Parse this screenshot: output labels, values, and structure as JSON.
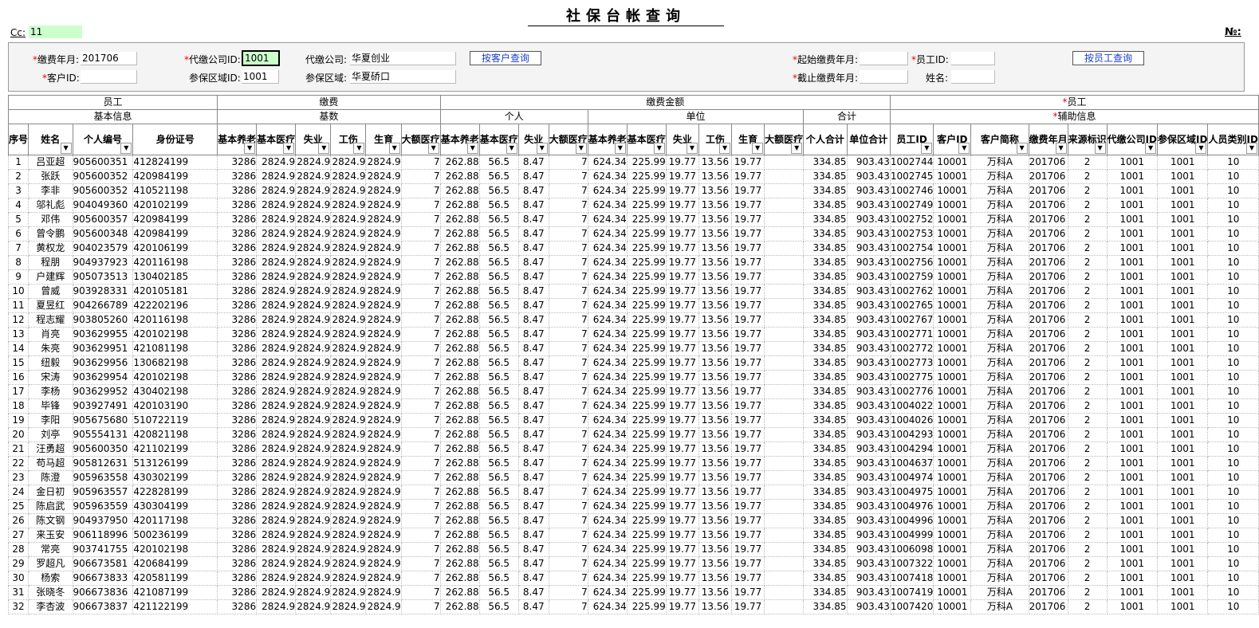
{
  "title": "社保台帐查询",
  "cc": {
    "label": "Cc:",
    "value": "11"
  },
  "no_label": "№:",
  "form": {
    "pay_month_label": "缴费年月:",
    "pay_month": "201706",
    "agent_company_id_label": "代缴公司ID:",
    "agent_company_id": "1001",
    "agent_company_label": "代缴公司:",
    "agent_company": "华夏创业",
    "customer_query_btn": "按客户查询",
    "start_month_label": "起始缴费年月:",
    "start_month": "",
    "employee_id_label": "员工ID:",
    "employee_id": "",
    "employee_query_btn": "按员工查询",
    "customer_id_label": "客户ID:",
    "customer_id": "",
    "region_id_label": "参保区域ID:",
    "region_id": "1001",
    "region_label": "参保区域:",
    "region": "华夏硚口",
    "end_month_label": "截止缴费年月:",
    "end_month": "",
    "name_label": "姓名:",
    "name": ""
  },
  "groups": {
    "employee": "员工",
    "basic_info": "基本信息",
    "payment": "缴费",
    "base": "基数",
    "amount": "缴费金额",
    "personal": "个人",
    "unit": "单位",
    "total": "合计",
    "employee2": "员工",
    "aux_info": "辅助信息"
  },
  "columns": [
    "序号",
    "姓名",
    "个人编号",
    "身份证号",
    "基本养老",
    "基本医疗",
    "失业",
    "工伤",
    "生育",
    "大额医疗",
    "基本养老",
    "基本医疗",
    "失业",
    "大额医疗",
    "基本养老",
    "基本医疗",
    "失业",
    "工伤",
    "生育",
    "大额医疗",
    "个人合计",
    "单位合计",
    "员工ID",
    "客户ID",
    "客户简称",
    "缴费年月",
    "来源标识",
    "代缴公司ID",
    "参保区域ID",
    "人员类别ID"
  ],
  "rows": [
    [
      "1",
      "吕亚超",
      "905600351",
      "412824199",
      "3286",
      "2824.9",
      "2824.9",
      "2824.9",
      "2824.9",
      "7",
      "262.88",
      "56.5",
      "8.47",
      "7",
      "624.34",
      "225.99",
      "19.77",
      "13.56",
      "19.77",
      "",
      "334.85",
      "903.43",
      "1002744",
      "10001",
      "万科A",
      "201706",
      "2",
      "1001",
      "1001",
      "10"
    ],
    [
      "2",
      "张跃",
      "905600352",
      "420984199",
      "3286",
      "2824.9",
      "2824.9",
      "2824.9",
      "2824.9",
      "7",
      "262.88",
      "56.5",
      "8.47",
      "7",
      "624.34",
      "225.99",
      "19.77",
      "13.56",
      "19.77",
      "",
      "334.85",
      "903.43",
      "1002745",
      "10001",
      "万科A",
      "201706",
      "2",
      "1001",
      "1001",
      "10"
    ],
    [
      "3",
      "李非",
      "905600352",
      "410521198",
      "3286",
      "2824.9",
      "2824.9",
      "2824.9",
      "2824.9",
      "7",
      "262.88",
      "56.5",
      "8.47",
      "7",
      "624.34",
      "225.99",
      "19.77",
      "13.56",
      "19.77",
      "",
      "334.85",
      "903.43",
      "1002746",
      "10001",
      "万科A",
      "201706",
      "2",
      "1001",
      "1001",
      "10"
    ],
    [
      "4",
      "邬礼彪",
      "904049360",
      "420102199",
      "3286",
      "2824.9",
      "2824.9",
      "2824.9",
      "2824.9",
      "7",
      "262.88",
      "56.5",
      "8.47",
      "7",
      "624.34",
      "225.99",
      "19.77",
      "13.56",
      "19.77",
      "",
      "334.85",
      "903.43",
      "1002749",
      "10001",
      "万科A",
      "201706",
      "2",
      "1001",
      "1001",
      "10"
    ],
    [
      "5",
      "邓伟",
      "905600357",
      "420984199",
      "3286",
      "2824.9",
      "2824.9",
      "2824.9",
      "2824.9",
      "7",
      "262.88",
      "56.5",
      "8.47",
      "7",
      "624.34",
      "225.99",
      "19.77",
      "13.56",
      "19.77",
      "",
      "334.85",
      "903.43",
      "1002752",
      "10001",
      "万科A",
      "201706",
      "2",
      "1001",
      "1001",
      "10"
    ],
    [
      "6",
      "曾令鹏",
      "905600348",
      "420984199",
      "3286",
      "2824.9",
      "2824.9",
      "2824.9",
      "2824.9",
      "7",
      "262.88",
      "56.5",
      "8.47",
      "7",
      "624.34",
      "225.99",
      "19.77",
      "13.56",
      "19.77",
      "",
      "334.85",
      "903.43",
      "1002753",
      "10001",
      "万科A",
      "201706",
      "2",
      "1001",
      "1001",
      "10"
    ],
    [
      "7",
      "黄权龙",
      "904023579",
      "420106199",
      "3286",
      "2824.9",
      "2824.9",
      "2824.9",
      "2824.9",
      "7",
      "262.88",
      "56.5",
      "8.47",
      "7",
      "624.34",
      "225.99",
      "19.77",
      "13.56",
      "19.77",
      "",
      "334.85",
      "903.43",
      "1002754",
      "10001",
      "万科A",
      "201706",
      "2",
      "1001",
      "1001",
      "10"
    ],
    [
      "8",
      "程朋",
      "904937923",
      "420116198",
      "3286",
      "2824.9",
      "2824.9",
      "2824.9",
      "2824.9",
      "7",
      "262.88",
      "56.5",
      "8.47",
      "7",
      "624.34",
      "225.99",
      "19.77",
      "13.56",
      "19.77",
      "",
      "334.85",
      "903.43",
      "1002756",
      "10001",
      "万科A",
      "201706",
      "2",
      "1001",
      "1001",
      "10"
    ],
    [
      "9",
      "户建辉",
      "905073513",
      "130402185",
      "3286",
      "2824.9",
      "2824.9",
      "2824.9",
      "2824.9",
      "7",
      "262.88",
      "56.5",
      "8.47",
      "7",
      "624.34",
      "225.99",
      "19.77",
      "13.56",
      "19.77",
      "",
      "334.85",
      "903.43",
      "1002759",
      "10001",
      "万科A",
      "201706",
      "2",
      "1001",
      "1001",
      "10"
    ],
    [
      "10",
      "曾威",
      "903928331",
      "420105181",
      "3286",
      "2824.9",
      "2824.9",
      "2824.9",
      "2824.9",
      "7",
      "262.88",
      "56.5",
      "8.47",
      "7",
      "624.34",
      "225.99",
      "19.77",
      "13.56",
      "19.77",
      "",
      "334.85",
      "903.43",
      "1002762",
      "10001",
      "万科A",
      "201706",
      "2",
      "1001",
      "1001",
      "10"
    ],
    [
      "11",
      "夏昱红",
      "904266789",
      "422202196",
      "3286",
      "2824.9",
      "2824.9",
      "2824.9",
      "2824.9",
      "7",
      "262.88",
      "56.5",
      "8.47",
      "7",
      "624.34",
      "225.99",
      "19.77",
      "13.56",
      "19.77",
      "",
      "334.85",
      "903.43",
      "1002765",
      "10001",
      "万科A",
      "201706",
      "2",
      "1001",
      "1001",
      "10"
    ],
    [
      "12",
      "程志耀",
      "903805260",
      "420116198",
      "3286",
      "2824.9",
      "2824.9",
      "2824.9",
      "2824.9",
      "7",
      "262.88",
      "56.5",
      "8.47",
      "7",
      "624.34",
      "225.99",
      "19.77",
      "13.56",
      "19.77",
      "",
      "334.85",
      "903.43",
      "1002767",
      "10001",
      "万科A",
      "201706",
      "2",
      "1001",
      "1001",
      "10"
    ],
    [
      "13",
      "肖亮",
      "903629955",
      "420102198",
      "3286",
      "2824.9",
      "2824.9",
      "2824.9",
      "2824.9",
      "7",
      "262.88",
      "56.5",
      "8.47",
      "7",
      "624.34",
      "225.99",
      "19.77",
      "13.56",
      "19.77",
      "",
      "334.85",
      "903.43",
      "1002771",
      "10001",
      "万科A",
      "201706",
      "2",
      "1001",
      "1001",
      "10"
    ],
    [
      "14",
      "朱亮",
      "903629951",
      "421081198",
      "3286",
      "2824.9",
      "2824.9",
      "2824.9",
      "2824.9",
      "7",
      "262.88",
      "56.5",
      "8.47",
      "7",
      "624.34",
      "225.99",
      "19.77",
      "13.56",
      "19.77",
      "",
      "334.85",
      "903.43",
      "1002772",
      "10001",
      "万科A",
      "201706",
      "2",
      "1001",
      "1001",
      "10"
    ],
    [
      "15",
      "纽毅",
      "903629956",
      "130682198",
      "3286",
      "2824.9",
      "2824.9",
      "2824.9",
      "2824.9",
      "7",
      "262.88",
      "56.5",
      "8.47",
      "7",
      "624.34",
      "225.99",
      "19.77",
      "13.56",
      "19.77",
      "",
      "334.85",
      "903.43",
      "1002773",
      "10001",
      "万科A",
      "201706",
      "2",
      "1001",
      "1001",
      "10"
    ],
    [
      "16",
      "宋涛",
      "903629954",
      "420102198",
      "3286",
      "2824.9",
      "2824.9",
      "2824.9",
      "2824.9",
      "7",
      "262.88",
      "56.5",
      "8.47",
      "7",
      "624.34",
      "225.99",
      "19.77",
      "13.56",
      "19.77",
      "",
      "334.85",
      "903.43",
      "1002775",
      "10001",
      "万科A",
      "201706",
      "2",
      "1001",
      "1001",
      "10"
    ],
    [
      "17",
      "李杨",
      "903629952",
      "430402198",
      "3286",
      "2824.9",
      "2824.9",
      "2824.9",
      "2824.9",
      "7",
      "262.88",
      "56.5",
      "8.47",
      "7",
      "624.34",
      "225.99",
      "19.77",
      "13.56",
      "19.77",
      "",
      "334.85",
      "903.43",
      "1002776",
      "10001",
      "万科A",
      "201706",
      "2",
      "1001",
      "1001",
      "10"
    ],
    [
      "18",
      "毕锋",
      "903927491",
      "420103190",
      "3286",
      "2824.9",
      "2824.9",
      "2824.9",
      "2824.9",
      "7",
      "262.88",
      "56.5",
      "8.47",
      "7",
      "624.34",
      "225.99",
      "19.77",
      "13.56",
      "19.77",
      "",
      "334.85",
      "903.43",
      "1004022",
      "10001",
      "万科A",
      "201706",
      "2",
      "1001",
      "1001",
      "10"
    ],
    [
      "19",
      "李阳",
      "905675680",
      "510722119",
      "3286",
      "2824.9",
      "2824.9",
      "2824.9",
      "2824.9",
      "7",
      "262.88",
      "56.5",
      "8.47",
      "7",
      "624.34",
      "225.99",
      "19.77",
      "13.56",
      "19.77",
      "",
      "334.85",
      "903.43",
      "1004026",
      "10001",
      "万科A",
      "201706",
      "2",
      "1001",
      "1001",
      "10"
    ],
    [
      "20",
      "刘亭",
      "905554131",
      "420821198",
      "3286",
      "2824.9",
      "2824.9",
      "2824.9",
      "2824.9",
      "7",
      "262.88",
      "56.5",
      "8.47",
      "7",
      "624.34",
      "225.99",
      "19.77",
      "13.56",
      "19.77",
      "",
      "334.85",
      "903.43",
      "1004293",
      "10001",
      "万科A",
      "201706",
      "2",
      "1001",
      "1001",
      "10"
    ],
    [
      "21",
      "汪勇超",
      "905600350",
      "421102199",
      "3286",
      "2824.9",
      "2824.9",
      "2824.9",
      "2824.9",
      "7",
      "262.88",
      "56.5",
      "8.47",
      "7",
      "624.34",
      "225.99",
      "19.77",
      "13.56",
      "19.77",
      "",
      "334.85",
      "903.43",
      "1004294",
      "10001",
      "万科A",
      "201706",
      "2",
      "1001",
      "1001",
      "10"
    ],
    [
      "22",
      "苟马超",
      "905812631",
      "513126199",
      "3286",
      "2824.9",
      "2824.9",
      "2824.9",
      "2824.9",
      "7",
      "262.88",
      "56.5",
      "8.47",
      "7",
      "624.34",
      "225.99",
      "19.77",
      "13.56",
      "19.77",
      "",
      "334.85",
      "903.43",
      "1004637",
      "10001",
      "万科A",
      "201706",
      "2",
      "1001",
      "1001",
      "10"
    ],
    [
      "23",
      "陈澄",
      "905963558",
      "430302199",
      "3286",
      "2824.9",
      "2824.9",
      "2824.9",
      "2824.9",
      "7",
      "262.88",
      "56.5",
      "8.47",
      "7",
      "624.34",
      "225.99",
      "19.77",
      "13.56",
      "19.77",
      "",
      "334.85",
      "903.43",
      "1004974",
      "10001",
      "万科A",
      "201706",
      "2",
      "1001",
      "1001",
      "10"
    ],
    [
      "24",
      "金日初",
      "905963557",
      "422828199",
      "3286",
      "2824.9",
      "2824.9",
      "2824.9",
      "2824.9",
      "7",
      "262.88",
      "56.5",
      "8.47",
      "7",
      "624.34",
      "225.99",
      "19.77",
      "13.56",
      "19.77",
      "",
      "334.85",
      "903.43",
      "1004975",
      "10001",
      "万科A",
      "201706",
      "2",
      "1001",
      "1001",
      "10"
    ],
    [
      "25",
      "陈启武",
      "905963559",
      "430304199",
      "3286",
      "2824.9",
      "2824.9",
      "2824.9",
      "2824.9",
      "7",
      "262.88",
      "56.5",
      "8.47",
      "7",
      "624.34",
      "225.99",
      "19.77",
      "13.56",
      "19.77",
      "",
      "334.85",
      "903.43",
      "1004976",
      "10001",
      "万科A",
      "201706",
      "2",
      "1001",
      "1001",
      "10"
    ],
    [
      "26",
      "陈文钢",
      "904937950",
      "420117198",
      "3286",
      "2824.9",
      "2824.9",
      "2824.9",
      "2824.9",
      "7",
      "262.88",
      "56.5",
      "8.47",
      "7",
      "624.34",
      "225.99",
      "19.77",
      "13.56",
      "19.77",
      "",
      "334.85",
      "903.43",
      "1004996",
      "10001",
      "万科A",
      "201706",
      "2",
      "1001",
      "1001",
      "10"
    ],
    [
      "27",
      "来玉安",
      "906118996",
      "500236199",
      "3286",
      "2824.9",
      "2824.9",
      "2824.9",
      "2824.9",
      "7",
      "262.88",
      "56.5",
      "8.47",
      "7",
      "624.34",
      "225.99",
      "19.77",
      "13.56",
      "19.77",
      "",
      "334.85",
      "903.43",
      "1004999",
      "10001",
      "万科A",
      "201706",
      "2",
      "1001",
      "1001",
      "10"
    ],
    [
      "28",
      "常亮",
      "903741755",
      "420102198",
      "3286",
      "2824.9",
      "2824.9",
      "2824.9",
      "2824.9",
      "7",
      "262.88",
      "56.5",
      "8.47",
      "7",
      "624.34",
      "225.99",
      "19.77",
      "13.56",
      "19.77",
      "",
      "334.85",
      "903.43",
      "1006098",
      "10001",
      "万科A",
      "201706",
      "2",
      "1001",
      "1001",
      "10"
    ],
    [
      "29",
      "罗超凡",
      "906673581",
      "420684199",
      "3286",
      "2824.9",
      "2824.9",
      "2824.9",
      "2824.9",
      "7",
      "262.88",
      "56.5",
      "8.47",
      "7",
      "624.34",
      "225.99",
      "19.77",
      "13.56",
      "19.77",
      "",
      "334.85",
      "903.43",
      "1007322",
      "10001",
      "万科A",
      "201706",
      "2",
      "1001",
      "1001",
      "10"
    ],
    [
      "30",
      "杨索",
      "906673833",
      "420581199",
      "3286",
      "2824.9",
      "2824.9",
      "2824.9",
      "2824.9",
      "7",
      "262.88",
      "56.5",
      "8.47",
      "7",
      "624.34",
      "225.99",
      "19.77",
      "13.56",
      "19.77",
      "",
      "334.85",
      "903.43",
      "1007418",
      "10001",
      "万科A",
      "201706",
      "2",
      "1001",
      "1001",
      "10"
    ],
    [
      "31",
      "张晓冬",
      "906673836",
      "421087199",
      "3286",
      "2824.9",
      "2824.9",
      "2824.9",
      "2824.9",
      "7",
      "262.88",
      "56.5",
      "8.47",
      "7",
      "624.34",
      "225.99",
      "19.77",
      "13.56",
      "19.77",
      "",
      "334.85",
      "903.43",
      "1007419",
      "10001",
      "万科A",
      "201706",
      "2",
      "1001",
      "1001",
      "10"
    ],
    [
      "32",
      "李杏波",
      "906673837",
      "421122199",
      "3286",
      "2824.9",
      "2824.9",
      "2824.9",
      "2824.9",
      "7",
      "262.88",
      "56.5",
      "8.47",
      "7",
      "624.34",
      "225.99",
      "19.77",
      "13.56",
      "19.77",
      "",
      "334.85",
      "903.43",
      "1007420",
      "10001",
      "万科A",
      "201706",
      "2",
      "1001",
      "1001",
      "10"
    ]
  ]
}
